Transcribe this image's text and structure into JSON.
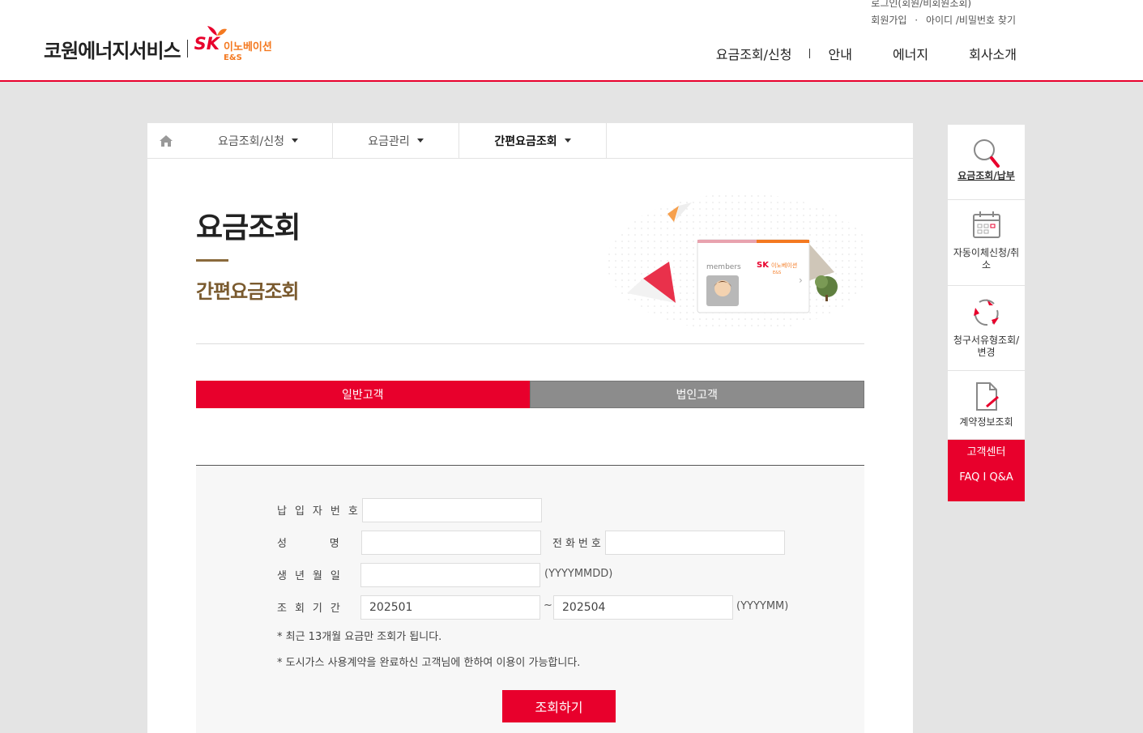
{
  "brand": {
    "name": "코원에너지서비스",
    "sk_letters": "SK",
    "sk_name": "이노베이션",
    "sk_sub": "E&S"
  },
  "util": {
    "login": "로그인(회원/비회원조회)",
    "join": "회원가입",
    "dot": "·",
    "find": "아이디 /비밀번호 찾기"
  },
  "gnb": [
    "요금조회/신청",
    "안내",
    "에너지",
    "회사소개"
  ],
  "lnb": {
    "menus": [
      "요금조회/신청",
      "요금관리",
      "간편요금조회"
    ]
  },
  "page": {
    "title": "요금조회",
    "subtitle": "간편요금조회"
  },
  "hero": {
    "card_label": "members",
    "card_brand": "SK",
    "card_brand_name": "이노베이션",
    "card_brand_sub": "E&S"
  },
  "tabs": [
    "일반고객",
    "법인고객"
  ],
  "form": {
    "payer_label": "납입자번호",
    "name_label": "성      명",
    "phone_label": "전화번호",
    "birth_label": "생년월일",
    "birth_hint": "(YYYYMMDD)",
    "period_label": "조회기간",
    "period_from": "202501",
    "period_to": "202504",
    "period_sep": "~",
    "period_hint": "(YYYYMM)",
    "note1": "* 최근 13개월 요금만 조회가 됩니다.",
    "note2": "* 도시가스 사용계약을 완료하신 고객님에 한하여 이용이 가능합니다.",
    "submit": "조회하기"
  },
  "quick": {
    "items": [
      {
        "label": "요금조회/납부",
        "icon": "magnifier-icon"
      },
      {
        "label": "자동이체신청/취소",
        "icon": "calendar-icon"
      },
      {
        "label": "청구서유형조회/변경",
        "icon": "recycle-icon"
      },
      {
        "label": "계약정보조회",
        "icon": "document-pen-icon"
      }
    ],
    "cs_title": "고객센터",
    "cs_links": "FAQ I Q&A"
  },
  "colors": {
    "accent": "#e8002c",
    "brown": "#7a5a2e",
    "tab_off": "#8c8c8c"
  }
}
